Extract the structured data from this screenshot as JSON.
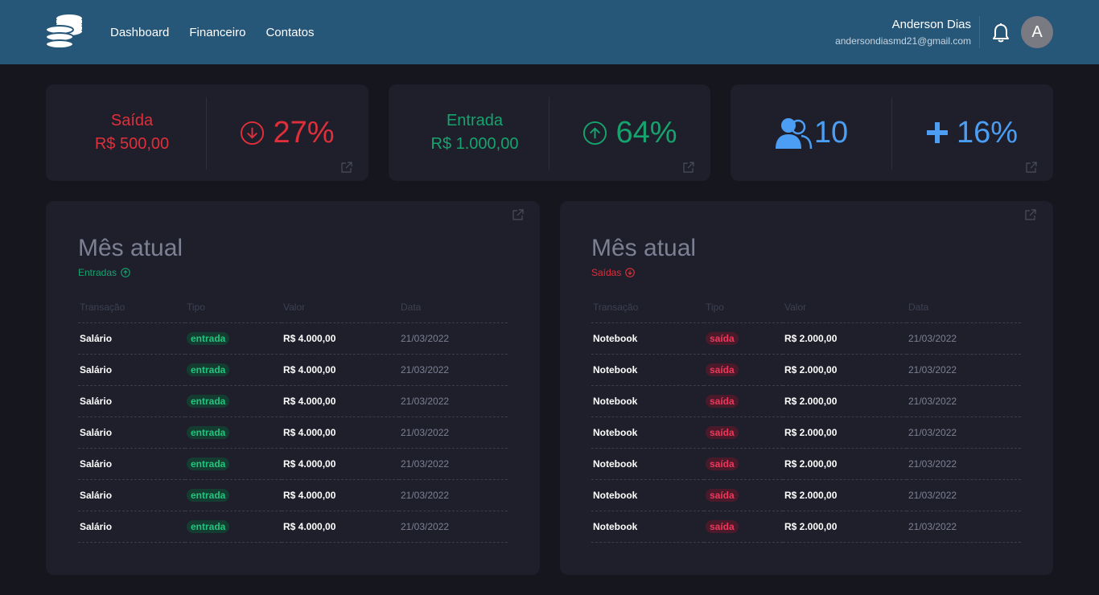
{
  "header": {
    "nav": [
      "Dashboard",
      "Financeiro",
      "Contatos"
    ],
    "user_name": "Anderson Dias",
    "user_email": "andersondiasmd21@gmail.com",
    "avatar_letter": "A"
  },
  "stats": {
    "saida": {
      "label": "Saída",
      "amount": "R$ 500,00",
      "percent": "27%",
      "color": "#e02f3a"
    },
    "entrada": {
      "label": "Entrada",
      "amount": "R$ 1.000,00",
      "percent": "64%",
      "color": "#16a36e"
    },
    "contacts": {
      "count": "10",
      "percent": "16%",
      "color": "#4b9ef3"
    }
  },
  "entradas_panel": {
    "title": "Mês atual",
    "subtitle": "Entradas",
    "columns": [
      "Transação",
      "Tipo",
      "Valor",
      "Data"
    ],
    "rows": [
      {
        "transacao": "Salário",
        "tipo": "entrada",
        "valor": "R$ 4.000,00",
        "data": "21/03/2022"
      },
      {
        "transacao": "Salário",
        "tipo": "entrada",
        "valor": "R$ 4.000,00",
        "data": "21/03/2022"
      },
      {
        "transacao": "Salário",
        "tipo": "entrada",
        "valor": "R$ 4.000,00",
        "data": "21/03/2022"
      },
      {
        "transacao": "Salário",
        "tipo": "entrada",
        "valor": "R$ 4.000,00",
        "data": "21/03/2022"
      },
      {
        "transacao": "Salário",
        "tipo": "entrada",
        "valor": "R$ 4.000,00",
        "data": "21/03/2022"
      },
      {
        "transacao": "Salário",
        "tipo": "entrada",
        "valor": "R$ 4.000,00",
        "data": "21/03/2022"
      },
      {
        "transacao": "Salário",
        "tipo": "entrada",
        "valor": "R$ 4.000,00",
        "data": "21/03/2022"
      }
    ]
  },
  "saidas_panel": {
    "title": "Mês atual",
    "subtitle": "Saídas",
    "columns": [
      "Transação",
      "Tipo",
      "Valor",
      "Data"
    ],
    "rows": [
      {
        "transacao": "Notebook",
        "tipo": "saída",
        "valor": "R$ 2.000,00",
        "data": "21/03/2022"
      },
      {
        "transacao": "Notebook",
        "tipo": "saída",
        "valor": "R$ 2.000,00",
        "data": "21/03/2022"
      },
      {
        "transacao": "Notebook",
        "tipo": "saída",
        "valor": "R$ 2.000,00",
        "data": "21/03/2022"
      },
      {
        "transacao": "Notebook",
        "tipo": "saída",
        "valor": "R$ 2.000,00",
        "data": "21/03/2022"
      },
      {
        "transacao": "Notebook",
        "tipo": "saída",
        "valor": "R$ 2.000,00",
        "data": "21/03/2022"
      },
      {
        "transacao": "Notebook",
        "tipo": "saída",
        "valor": "R$ 2.000,00",
        "data": "21/03/2022"
      },
      {
        "transacao": "Notebook",
        "tipo": "saída",
        "valor": "R$ 2.000,00",
        "data": "21/03/2022"
      }
    ]
  }
}
